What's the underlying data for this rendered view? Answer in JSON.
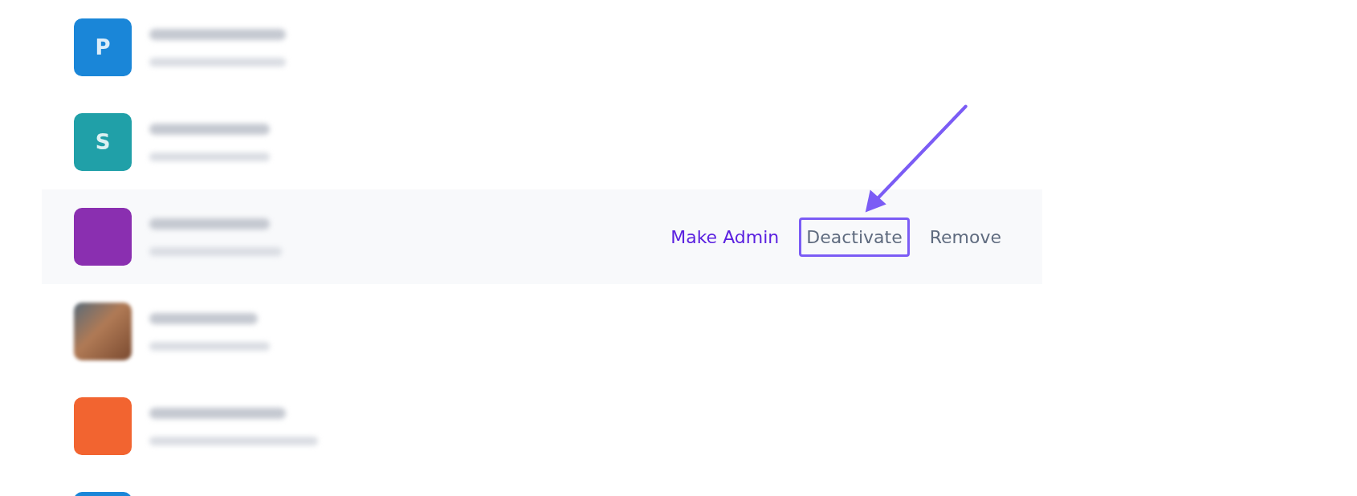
{
  "members": [
    {
      "avatar": {
        "kind": "letter",
        "initial": "P",
        "color": "#1a86d8"
      }
    },
    {
      "avatar": {
        "kind": "letter",
        "initial": "S",
        "color": "#20a0a8"
      }
    },
    {
      "avatar": {
        "kind": "letter",
        "color": "#8a2fb0"
      },
      "actions": [
        {
          "label": "Make Admin",
          "kind": "primary",
          "outlined": false
        },
        {
          "label": "Deactivate",
          "kind": "default",
          "outlined": true
        },
        {
          "label": "Remove",
          "kind": "default",
          "outlined": false
        }
      ]
    },
    {
      "avatar": {
        "kind": "photo"
      }
    },
    {
      "avatar": {
        "kind": "letter",
        "color": "#f26430"
      }
    },
    {
      "avatar": {
        "kind": "letter",
        "color": "#1a86d8"
      }
    }
  ]
}
